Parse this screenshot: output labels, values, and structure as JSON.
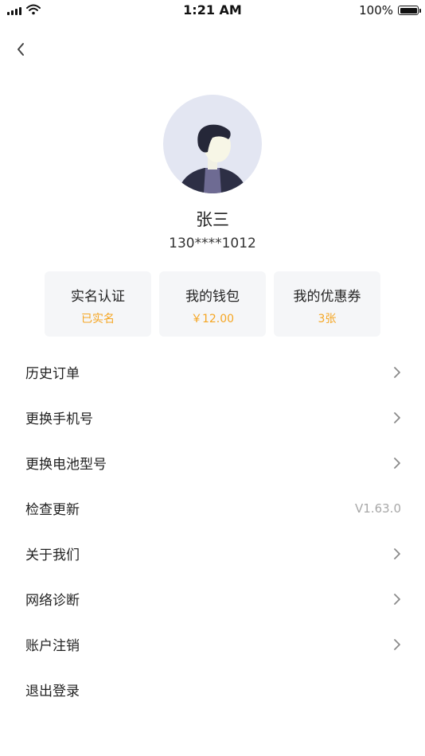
{
  "status_bar": {
    "time": "1:21 AM",
    "battery": "100%"
  },
  "profile": {
    "name": "张三",
    "phone": "130****1012"
  },
  "cards": [
    {
      "title": "实名认证",
      "value": "已实名"
    },
    {
      "title": "我的钱包",
      "value": "￥12.00"
    },
    {
      "title": "我的优惠券",
      "value": "3张"
    }
  ],
  "menu": [
    {
      "label": "历史订单"
    },
    {
      "label": "更换手机号"
    },
    {
      "label": "更换电池型号"
    },
    {
      "label": "检查更新",
      "value": "V1.63.0"
    },
    {
      "label": "关于我们"
    },
    {
      "label": "网络诊断"
    },
    {
      "label": "账户注销"
    },
    {
      "label": "退出登录"
    }
  ],
  "colors": {
    "accent": "#f5a623",
    "card_bg": "#f5f6f8",
    "avatar_bg": "#e3e6f2"
  }
}
